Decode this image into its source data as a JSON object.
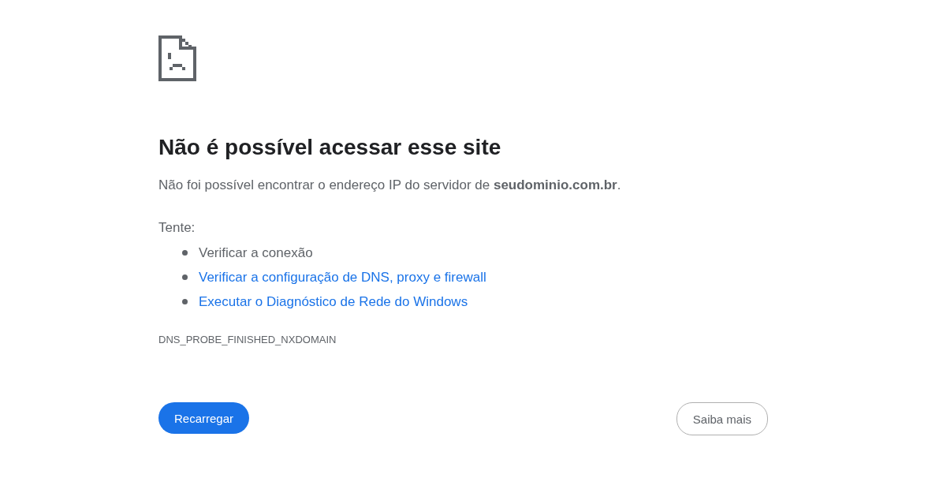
{
  "heading": "Não é possível acessar esse site",
  "message": "Não foi possível encontrar o endereço IP do servidor de **seudominio.com.br**.",
  "suggestions_label": "Tente:",
  "suggestions": [
    {
      "kind": "text",
      "text": "Verificar a conexão"
    },
    {
      "kind": "link",
      "text": "Verificar a configuração de DNS, proxy e firewall"
    },
    {
      "kind": "link",
      "text": "Executar o Diagnóstico de Rede do Windows"
    }
  ],
  "error_code": "DNS_PROBE_FINISHED_NXDOMAIN",
  "buttons": [
    {
      "kind": "primary",
      "label": "Recarregar"
    },
    {
      "kind": "secondary",
      "label": "Saiba mais"
    }
  ]
}
